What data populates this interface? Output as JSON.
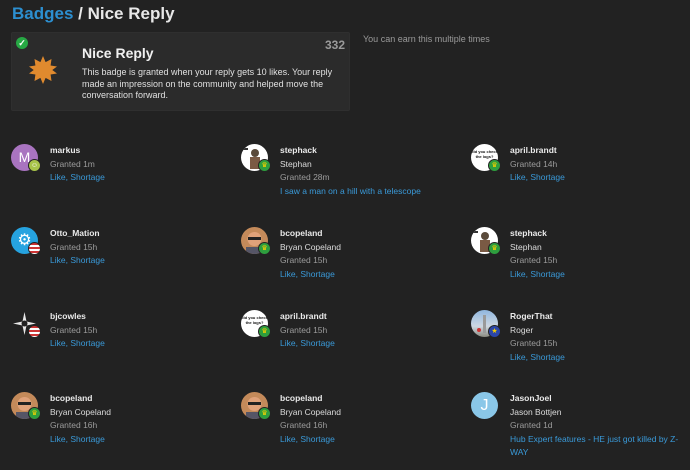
{
  "header": {
    "crumb": "Badges",
    "sep": " / ",
    "title": "Nice Reply"
  },
  "badge": {
    "name": "Nice Reply",
    "count": "332",
    "description": "This badge is granted when your reply gets 10 likes. Your reply made an impression on the community and helped move the conversation forward.",
    "earn_note": "You can earn this multiple times"
  },
  "grants": [
    {
      "username": "markus",
      "full_name": "",
      "time": "Granted 1m",
      "link": "Like, Shortage"
    },
    {
      "username": "stephack",
      "full_name": "Stephan",
      "time": "Granted 28m",
      "link": "I saw a man on a hill with a telescope"
    },
    {
      "username": "april.brandt",
      "full_name": "",
      "time": "Granted 14h",
      "link": "Like, Shortage"
    },
    {
      "username": "Otto_Mation",
      "full_name": "",
      "time": "Granted 15h",
      "link": "Like, Shortage"
    },
    {
      "username": "bcopeland",
      "full_name": "Bryan Copeland",
      "time": "Granted 15h",
      "link": "Like, Shortage"
    },
    {
      "username": "stephack",
      "full_name": "Stephan",
      "time": "Granted 15h",
      "link": "Like, Shortage"
    },
    {
      "username": "bjcowles",
      "full_name": "",
      "time": "Granted 15h",
      "link": "Like, Shortage"
    },
    {
      "username": "april.brandt",
      "full_name": "",
      "time": "Granted 15h",
      "link": "Like, Shortage"
    },
    {
      "username": "RogerThat",
      "full_name": "Roger",
      "time": "Granted 15h",
      "link": "Like, Shortage"
    },
    {
      "username": "bcopeland",
      "full_name": "Bryan Copeland",
      "time": "Granted 16h",
      "link": "Like, Shortage"
    },
    {
      "username": "bcopeland",
      "full_name": "Bryan Copeland",
      "time": "Granted 16h",
      "link": "Like, Shortage"
    },
    {
      "username": "JasonJoel",
      "full_name": "Jason Bottjen",
      "time": "Granted 1d",
      "link": "Hub Expert features - HE just got killed by Z-WAY"
    }
  ],
  "avatar_letters": {
    "markus": "M",
    "JasonJoel": "J",
    "april.brandt": "did you check the logs?"
  },
  "colors": {
    "accent": "#2c8fd0",
    "markus": "#a974c0",
    "jason": "#8ac7e8",
    "otto": "#26a3e0",
    "flair_green": "#2e9e3e",
    "flair_olive": "#a8c44a"
  }
}
